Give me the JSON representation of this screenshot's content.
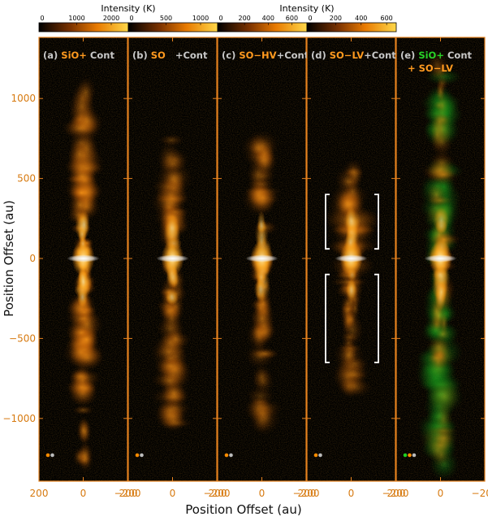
{
  "colorbars": [
    {
      "title": "Intensity (K)",
      "ticks": [
        "0",
        "1000",
        "2000"
      ],
      "max": 2400
    },
    {
      "title": "",
      "ticks": [
        "0",
        "500",
        "1000"
      ],
      "max": 1200
    },
    {
      "title": "Intensity (K)",
      "ticks": [
        "0",
        "200",
        "400",
        "600"
      ],
      "max": 700
    },
    {
      "title": "",
      "ticks": [
        "0",
        "200",
        "400",
        "600"
      ],
      "max": 650
    }
  ],
  "axes": {
    "xlabel": "Position Offset (au)",
    "ylabel": "Position Offset (au)",
    "xticks": [
      "200",
      "0",
      "−200"
    ],
    "yticks": [
      "1000",
      "500",
      "0",
      "−500",
      "−1000"
    ]
  },
  "panels": [
    {
      "letter": "(a)",
      "parts": [
        {
          "t": "SiO+",
          "c": "#ff9a1f"
        },
        {
          "t": " Cont",
          "c": "#c8c8c8"
        }
      ],
      "line2": []
    },
    {
      "letter": "(b)",
      "parts": [
        {
          "t": "SO",
          "c": "#ff9a1f"
        },
        {
          "t": "   +Cont",
          "c": "#c8c8c8"
        }
      ],
      "line2": []
    },
    {
      "letter": "(c)",
      "parts": [
        {
          "t": "SO−HV",
          "c": "#ff9a1f"
        },
        {
          "t": "+Cont",
          "c": "#c8c8c8"
        }
      ],
      "line2": []
    },
    {
      "letter": "(d)",
      "parts": [
        {
          "t": "SO−LV",
          "c": "#ff9a1f"
        },
        {
          "t": "+Cont",
          "c": "#c8c8c8"
        }
      ],
      "line2": []
    },
    {
      "letter": "(e)",
      "parts": [
        {
          "t": "SiO+",
          "c": "#28d228"
        },
        {
          "t": " Cont",
          "c": "#c8c8c8"
        }
      ],
      "line2": [
        {
          "t": "+ SO−LV",
          "c": "#ff9a1f"
        }
      ]
    }
  ],
  "colors": {
    "frame": "#e6821e",
    "background": "#000000",
    "emission": "#ff8c00",
    "sio": "#1fd01f",
    "continuum": "#ffffff"
  }
}
